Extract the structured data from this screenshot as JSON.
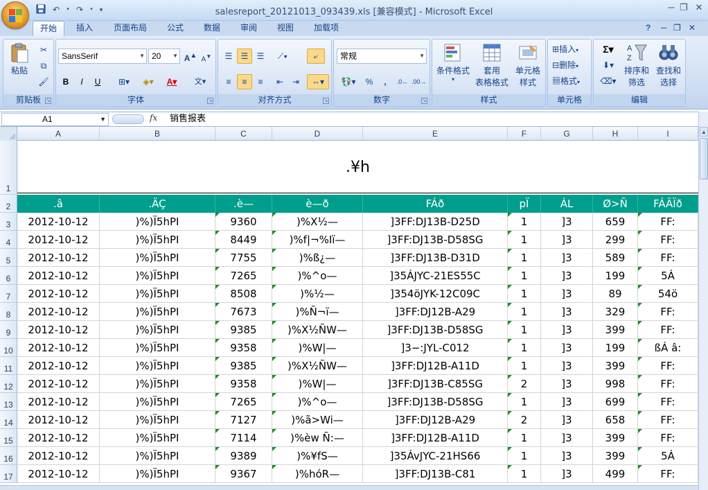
{
  "window": {
    "title": "salesreport_20121013_093439.xls  [兼容模式] - Microsoft Excel",
    "minimize": "─",
    "restore": "❐",
    "close": "✕"
  },
  "ribbon_tabs": [
    "开始",
    "插入",
    "页面布局",
    "公式",
    "数据",
    "审阅",
    "视图",
    "加载项"
  ],
  "ribbon": {
    "clipboard": {
      "label": "剪贴板",
      "paste": "粘贴"
    },
    "font": {
      "label": "字体",
      "name": "SansSerif",
      "size": "20",
      "bold": "B",
      "italic": "I",
      "underline": "U"
    },
    "alignment": {
      "label": "对齐方式"
    },
    "number": {
      "label": "数字",
      "format": "常规"
    },
    "styles": {
      "label": "样式",
      "cond_format": "条件格式",
      "table_format_1": "套用",
      "table_format_2": "表格格式",
      "cell_style_1": "单元格",
      "cell_style_2": "样式"
    },
    "cells": {
      "label": "单元格",
      "insert": "插入",
      "delete": "删除",
      "format": "格式"
    },
    "editing": {
      "label": "编辑",
      "sort_1": "排序和",
      "sort_2": "筛选",
      "find_1": "查找和",
      "find_2": "选择"
    }
  },
  "formula_bar": {
    "name_box": "A1",
    "fx": "fx",
    "content": "销售报表"
  },
  "columns": [
    "A",
    "B",
    "C",
    "D",
    "E",
    "F",
    "G",
    "H",
    "I"
  ],
  "rows": [
    "1",
    "2",
    "3",
    "4",
    "5",
    "6",
    "7",
    "8",
    "9",
    "10",
    "11",
    "12",
    "13",
    "14",
    "15",
    "16",
    "17"
  ],
  "title_cell": ".¥h",
  "header_row": [
    ".â",
    ".ÄÇ",
    ".è—",
    "è—ð",
    "FÁð",
    "pÏ",
    "ÁL",
    "Ø>Ñ",
    "FÁÄÏð"
  ],
  "data_rows": [
    [
      "2012-10-12",
      ")%)Ï5hPI",
      "9360",
      ")%X½—",
      "]3FF:DJ13B-D25D",
      "1",
      "]3",
      "659",
      "FF:"
    ],
    [
      "2012-10-12",
      ")%)Ï5hPI",
      "8449",
      ")%f|¬%Iï—",
      "]3FF:DJ13B-D58SG",
      "1",
      "]3",
      "299",
      "FF:"
    ],
    [
      "2012-10-12",
      ")%)Ï5hPI",
      "7755",
      ")%ß¿—",
      "]3FF:DJ13B-D31D",
      "1",
      "]3",
      "589",
      "FF:"
    ],
    [
      "2012-10-12",
      ")%)Ï5hPI",
      "7265",
      ")%^o—",
      "]35ÁJYC-21ES55C",
      "1",
      "]3",
      "199",
      "5Á"
    ],
    [
      "2012-10-12",
      ")%)Ï5hPI",
      "8508",
      ")%½—",
      "]354öJYK-12C09C",
      "1",
      "]3",
      "89",
      "54ö"
    ],
    [
      "2012-10-12",
      ")%)Ï5hPI",
      "7673",
      ")%Ñ¬ï—",
      "]3FF:DJ12B-A29",
      "1",
      "]3",
      "329",
      "FF:"
    ],
    [
      "2012-10-12",
      ")%)Ï5hPI",
      "9385",
      ")%X½ÑW—",
      "]3FF:DJ13B-D58SG",
      "1",
      "]3",
      "399",
      "FF:"
    ],
    [
      "2012-10-12",
      ")%)Ï5hPI",
      "9358",
      ")%W|—",
      "]3−:JYL-C012",
      "1",
      "]3",
      "199",
      "ßÁ â:"
    ],
    [
      "2012-10-12",
      ")%)Ï5hPI",
      "9385",
      ")%X½ÑW—",
      "]3FF:DJ12B-A11D",
      "1",
      "]3",
      "399",
      "FF:"
    ],
    [
      "2012-10-12",
      ")%)Ï5hPI",
      "9358",
      ")%W|—",
      "]3FF:DJ13B-C85SG",
      "2",
      "]3",
      "998",
      "FF:"
    ],
    [
      "2012-10-12",
      ")%)Ï5hPI",
      "7265",
      ")%^o—",
      "]3FF:DJ13B-D58SG",
      "1",
      "]3",
      "699",
      "FF:"
    ],
    [
      "2012-10-12",
      ")%)Ï5hPI",
      "7127",
      ")%ã>Wi—",
      "]3FF:DJ12B-A29",
      "2",
      "]3",
      "658",
      "FF:"
    ],
    [
      "2012-10-12",
      ")%)Ï5hPI",
      "7114",
      ")%èw  Ñ:—",
      "]3FF:DJ12B-A11D",
      "1",
      "]3",
      "399",
      "FF:"
    ],
    [
      "2012-10-12",
      ")%)Ï5hPI",
      "9389",
      ")%¥fS—",
      "]35ÁvJYC-21HS66",
      "1",
      "]3",
      "399",
      "5Á"
    ],
    [
      "2012-10-12",
      ")%)Ï5hPI",
      "9367",
      ")%hóR—",
      "]3FF:DJ13B-C81",
      "1",
      "]3",
      "499",
      "FF:"
    ]
  ],
  "colors": {
    "header_bg": "#009e8c",
    "ribbon_bg": "#cfdef3",
    "accent": "#15428b"
  }
}
